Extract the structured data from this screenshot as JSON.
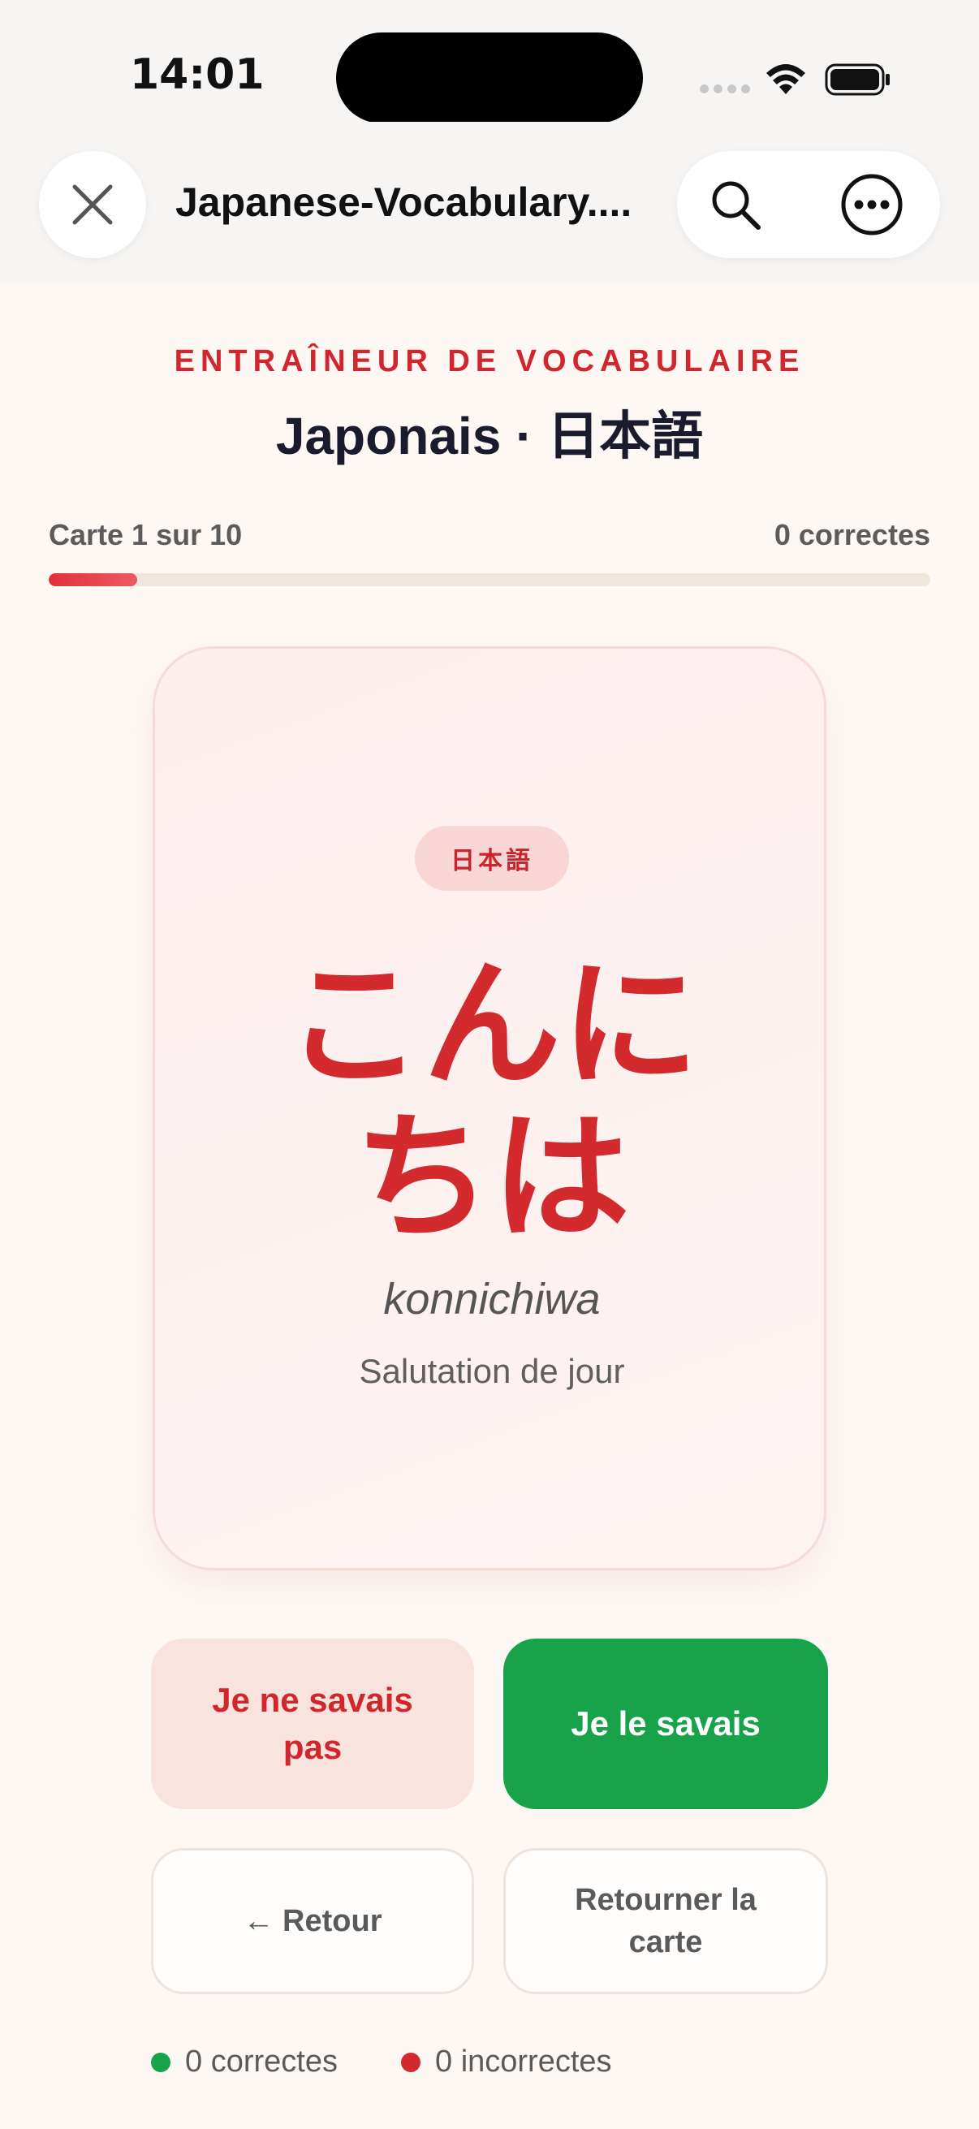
{
  "status_bar": {
    "time": "14:01"
  },
  "browser": {
    "page_name": "Japanese-Vocabulary...."
  },
  "header": {
    "eyebrow": "ENTRAÎNEUR DE VOCABULAIRE",
    "title": "Japonais · 日本語"
  },
  "progress": {
    "card_label": "Carte 1 sur 10",
    "correct_label": "0 correctes",
    "current": 1,
    "total": 10
  },
  "card": {
    "badge": "日本語",
    "word_line1": "こんに",
    "word_line2": "ちは",
    "romaji": "konnichiwa",
    "meaning": "Salutation de jour"
  },
  "actions": {
    "unknown_label": "Je ne savais pas",
    "known_label": "Je le savais",
    "back_label": "← Retour",
    "flip_label": "Retourner la carte"
  },
  "stats": {
    "correct": "0 correctes",
    "incorrect": "0 incorrectes"
  },
  "colors": {
    "accent_red": "#d32a2e",
    "success_green": "#18a34a",
    "background": "#fdf8f4"
  },
  "icons": {
    "close": "close-icon",
    "search": "search-icon",
    "more": "more-icon",
    "wifi": "wifi-icon",
    "battery": "battery-icon",
    "signal": "signal-icon"
  }
}
